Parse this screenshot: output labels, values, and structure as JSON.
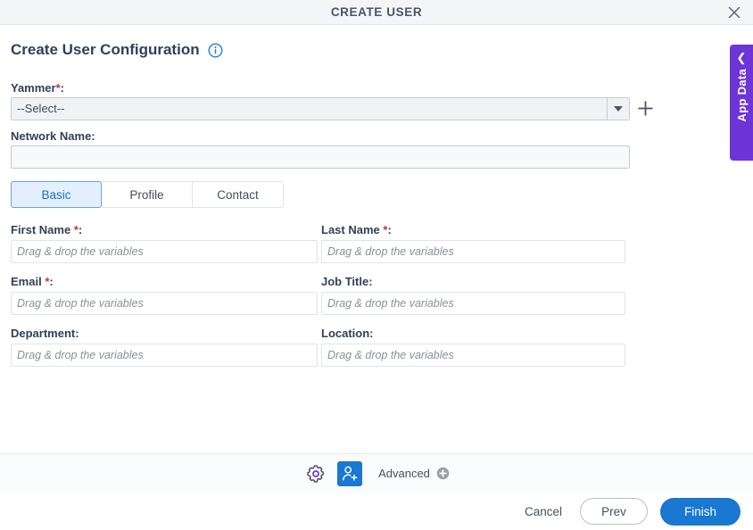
{
  "window": {
    "title": "CREATE USER",
    "close_icon": "close-icon"
  },
  "page": {
    "title": "Create User Configuration",
    "info_icon": "info-icon"
  },
  "yammer": {
    "label": "Yammer",
    "required_marker": "*",
    "colon": ":",
    "selected_value": "--Select--",
    "dropdown_icon": "chevron-down-icon",
    "add_icon": "plus-icon"
  },
  "network": {
    "label": "Network Name:",
    "value": "",
    "placeholder": ""
  },
  "tabs": [
    {
      "label": "Basic",
      "active": true
    },
    {
      "label": "Profile",
      "active": false
    },
    {
      "label": "Contact",
      "active": false
    }
  ],
  "fields": {
    "placeholder": "Drag & drop the variables",
    "rows": [
      {
        "left": {
          "label": "First Name",
          "required": true,
          "value": ""
        },
        "right": {
          "label": "Last Name",
          "required": true,
          "value": ""
        }
      },
      {
        "left": {
          "label": "Email",
          "required": true,
          "value": ""
        },
        "right": {
          "label": "Job Title",
          "required": false,
          "value": ""
        }
      },
      {
        "left": {
          "label": "Department",
          "required": false,
          "value": ""
        },
        "right": {
          "label": "Location",
          "required": false,
          "value": ""
        }
      }
    ]
  },
  "toolbar": {
    "settings_icon": "gear-icon",
    "create_user_icon": "add-user-icon",
    "advanced_label": "Advanced",
    "advanced_icon": "plus-circle-icon"
  },
  "footer": {
    "cancel_label": "Cancel",
    "prev_label": "Prev",
    "finish_label": "Finish"
  },
  "app_data_panel": {
    "label": "App Data",
    "collapse_icon": "chevron-left-icon"
  },
  "colors": {
    "accent_blue": "#1878d2",
    "tab_active_bg": "#e3f0fb",
    "tab_active_border": "#63a6e0",
    "tab_active_text": "#1a6fc4",
    "purple": "#6d34d6",
    "required_red": "#c0392b",
    "title_text": "#32405a",
    "header_bg": "#f4f5f7",
    "toolbar_bg": "#fafbfc",
    "gear_purple": "#7b2ff2",
    "advanced_icon_gray": "#9aa0a6"
  }
}
